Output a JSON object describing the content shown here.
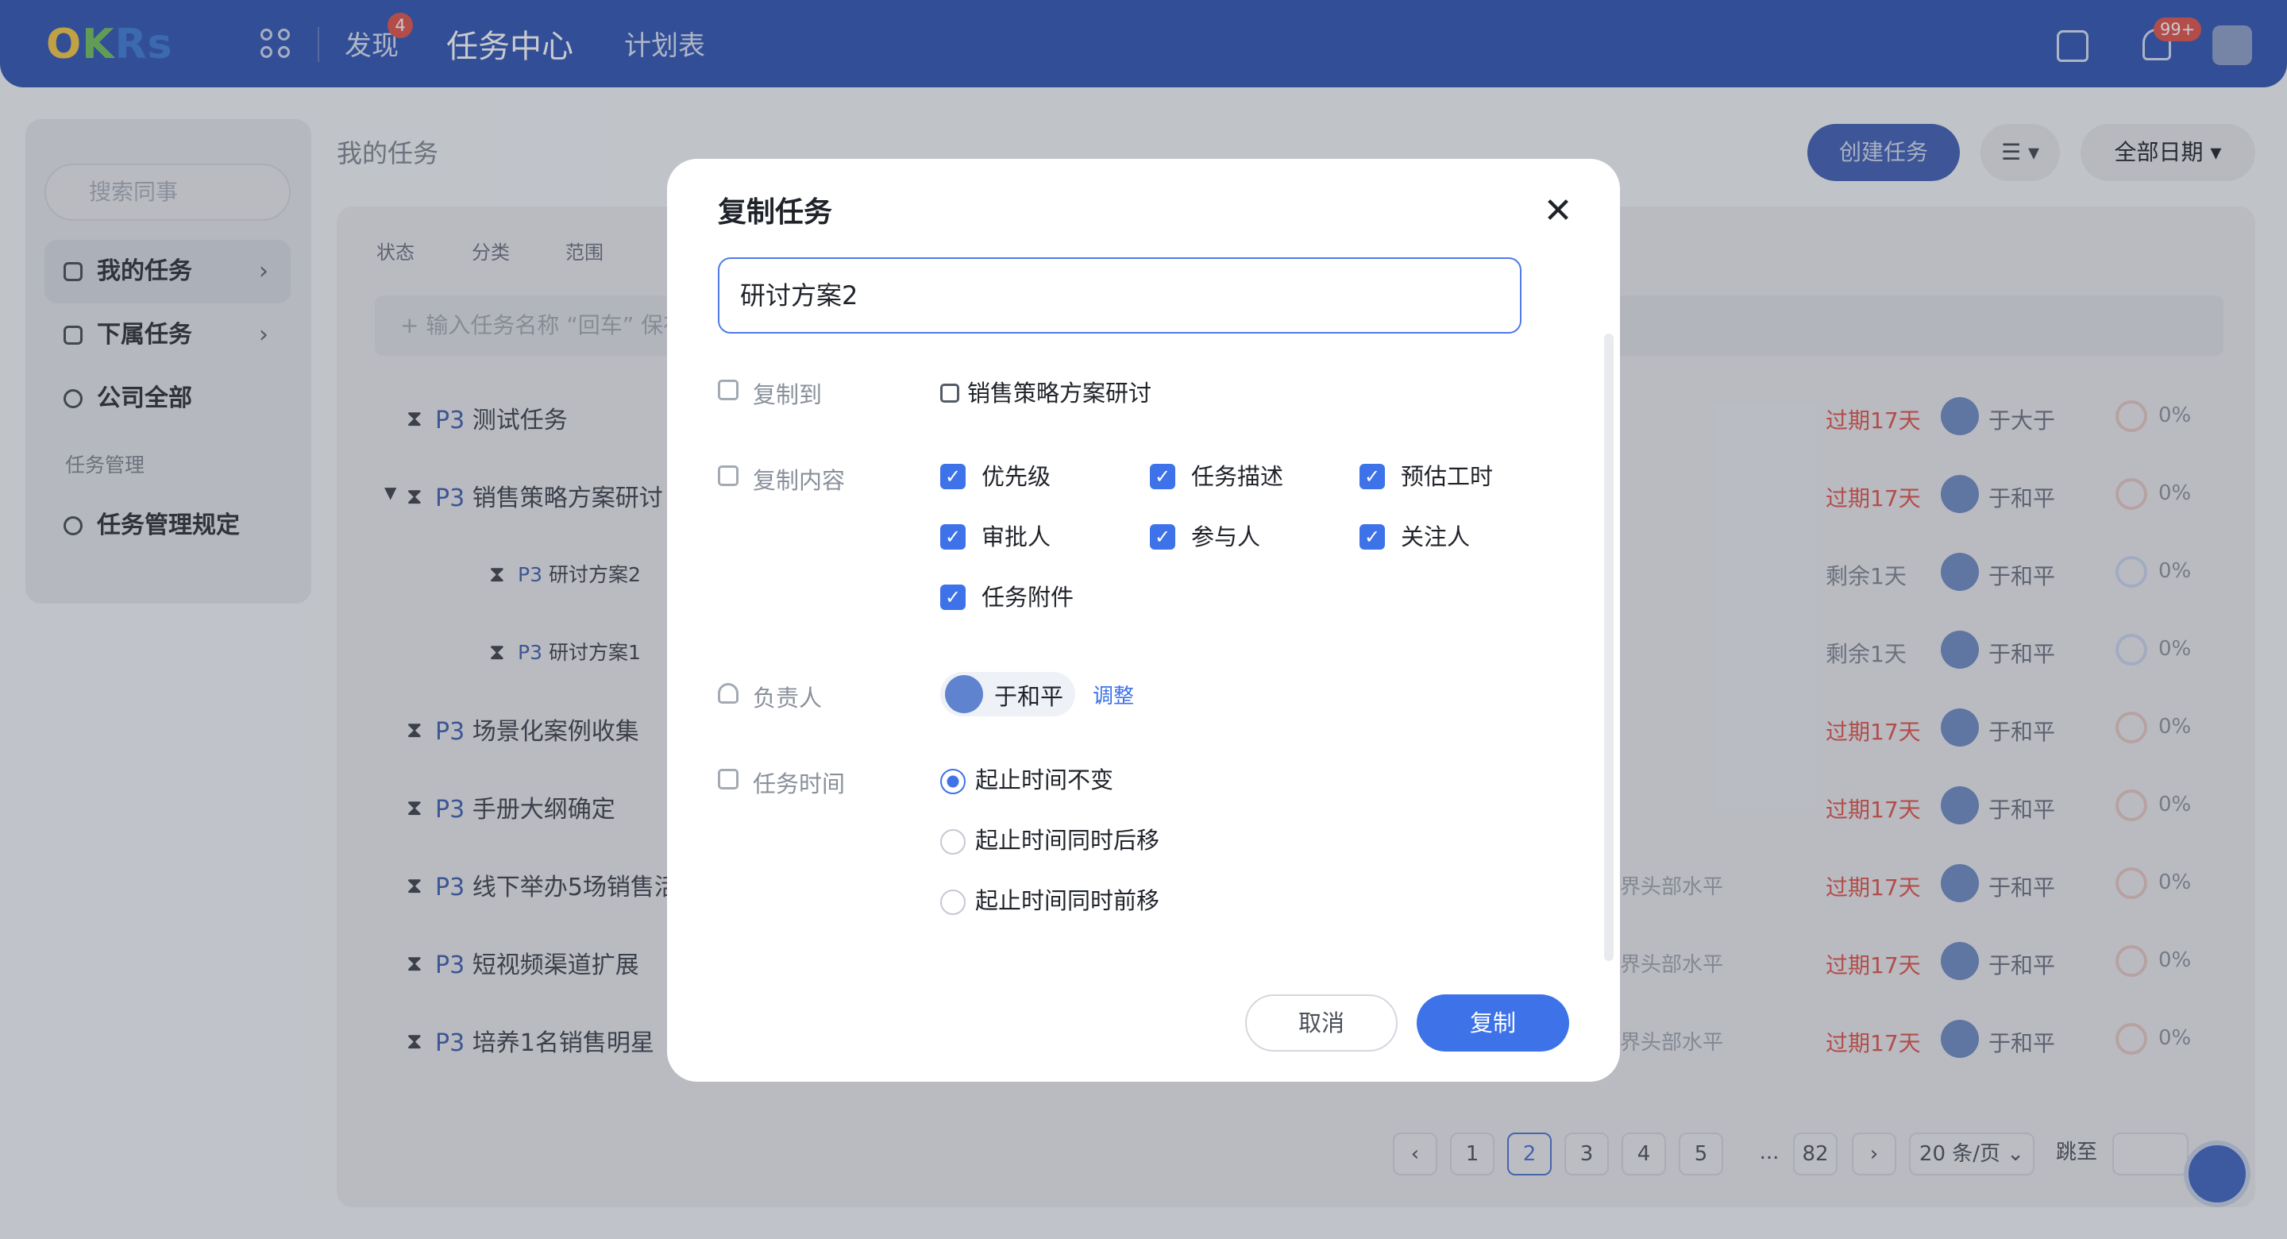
{
  "app": {
    "logo": "OKRs",
    "nav": [
      "发现",
      "任务中心",
      "计划表"
    ],
    "discover_badge": "4",
    "notif_badge": "99+"
  },
  "sidebar": {
    "search_placeholder": "搜索同事",
    "items": [
      {
        "label": "我的任务"
      },
      {
        "label": "下属任务"
      },
      {
        "label": "公司全部"
      }
    ],
    "section": "任务管理",
    "rules": "任务管理规定"
  },
  "main": {
    "title": "我的任务",
    "create": "创建任务",
    "date_filter": "全部日期",
    "view_icon": "list-icon",
    "filters": [
      "状态",
      "分类",
      "范围"
    ],
    "add_placeholder": "+ 输入任务名称 “回车” 保存",
    "rows": [
      {
        "priority": "P3",
        "name": "测试任务",
        "tag": "",
        "due": "过期17天",
        "owner": "于大于",
        "pct": "0%"
      },
      {
        "priority": "P3",
        "name": "销售策略方案研讨",
        "tag": "",
        "due": "过期17天",
        "owner": "于和平",
        "pct": "0%"
      },
      {
        "priority": "P3",
        "name": "研讨方案2",
        "tag": "",
        "due": "剩余1天",
        "owner": "于和平",
        "pct": "0%"
      },
      {
        "priority": "P3",
        "name": "研讨方案1",
        "tag": "",
        "due": "剩余1天",
        "owner": "于和平",
        "pct": "0%"
      },
      {
        "priority": "P3",
        "name": "场景化案例收集",
        "tag": "",
        "due": "过期17天",
        "owner": "于和平",
        "pct": "0%"
      },
      {
        "priority": "P3",
        "name": "手册大纲确定",
        "tag": "",
        "due": "过期17天",
        "owner": "于和平",
        "pct": "0%"
      },
      {
        "priority": "P3",
        "name": "线下举办5场销售活",
        "tag": "业界头部水平",
        "due": "过期17天",
        "owner": "于和平",
        "pct": "0%"
      },
      {
        "priority": "P3",
        "name": "短视频渠道扩展",
        "tag": "业界头部水平",
        "due": "过期17天",
        "owner": "于和平",
        "pct": "0%"
      },
      {
        "priority": "P3",
        "name": "培养1名销售明星",
        "tag": "业界头部水平",
        "due": "过期17天",
        "owner": "于和平",
        "pct": "0%"
      }
    ],
    "pagination": {
      "pages": [
        "1",
        "2",
        "3",
        "4",
        "5",
        "...",
        "82"
      ],
      "current": "2",
      "per_page": "20 条/页",
      "jump": "跳至"
    }
  },
  "modal": {
    "title": "复制任务",
    "input_value": "研讨方案2",
    "copy_to_label": "复制到",
    "copy_to_value": "销售策略方案研讨",
    "content_label": "复制内容",
    "content_options": [
      "优先级",
      "任务描述",
      "预估工时",
      "审批人",
      "参与人",
      "关注人",
      "任务附件"
    ],
    "owner_label": "负责人",
    "owner_name": "于和平",
    "adjust": "调整",
    "time_label": "任务时间",
    "time_options": [
      "起止时间不变",
      "起止时间同时后移",
      "起止时间同时前移"
    ],
    "cancel": "取消",
    "confirm": "复制"
  },
  "colors": {
    "primary": "#3d72e8",
    "topbar": "#2f54b3",
    "overdue": "#e0524a"
  }
}
